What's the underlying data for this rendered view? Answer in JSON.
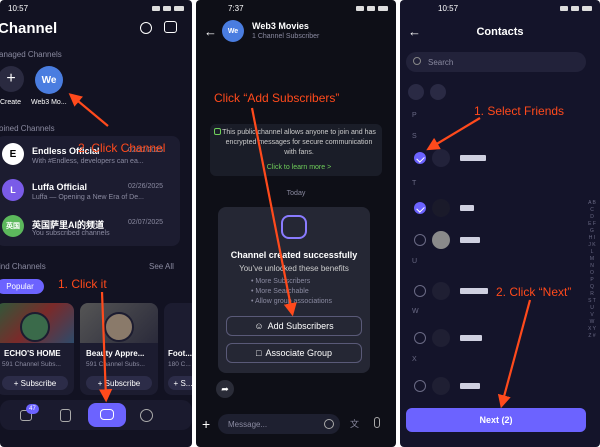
{
  "panel1": {
    "time": "10:57",
    "title": "Channel",
    "managed_label": "anaged Channels",
    "create_label": "Create",
    "web3_avatar": "We",
    "web3_label": "Web3 Mo...",
    "joined_label": "oined Channels",
    "channels": [
      {
        "name": "Endless Official",
        "date": "02/27/2025",
        "preview": "With #Endless, developers can ea..."
      },
      {
        "name": "Luffa Official",
        "date": "02/26/2025",
        "preview": "Luffa — Opening a New Era of De..."
      },
      {
        "name": "英国萨里AI的频道",
        "date": "02/07/2025",
        "preview": "You subscribed channels",
        "avatar": "英国"
      }
    ],
    "find_label": "ind Channels",
    "see_all": "See All",
    "popular": "Popular",
    "cards": [
      {
        "name": "ECHO'S HOME",
        "subs": "591 Channel Subs...",
        "btn": "+ Subscribe"
      },
      {
        "name": "Beauty Appre...",
        "subs": "591 Channel Subs...",
        "btn": "+ Subscribe"
      },
      {
        "name": "Foot...",
        "subs": "180 C...",
        "btn": "+ S..."
      }
    ],
    "badge": "47",
    "ann_click_channel": "2. Click Channel",
    "ann_click_it": "1. Click it"
  },
  "panel2": {
    "time": "7:37",
    "avatar": "We",
    "title": "Web3 Movies",
    "subtitle": "1 Channel Subscriber",
    "notice": "This public channel allows anyone to join and has encrypted messages for secure communication with fans.",
    "learn": "Click to learn more >",
    "today": "Today",
    "created": "Channel created successfully",
    "unlocked": "You've unlocked these benefits",
    "benefits": [
      "More Subscribers",
      "More Searchable",
      "Allow group associations"
    ],
    "add_btn": "Add Subscribers",
    "assoc_btn": "Associate Group",
    "placeholder": "Message...",
    "ann_add": "Click “Add Subscribers”"
  },
  "panel3": {
    "time": "10:57",
    "title": "Contacts",
    "search": "Search",
    "letters": [
      "P",
      "S",
      "T",
      "U",
      "V",
      "W",
      "X"
    ],
    "index": "A B C D E F G H I J K L M N O P Q R S T U V W X Y Z #",
    "next": "Next (2)",
    "ann_select": "1. Select Friends",
    "ann_next": "2. Click “Next”"
  },
  "colors": {
    "accent": "#6c63ff",
    "annotation": "#ff4a1c",
    "bg": "#121222"
  }
}
